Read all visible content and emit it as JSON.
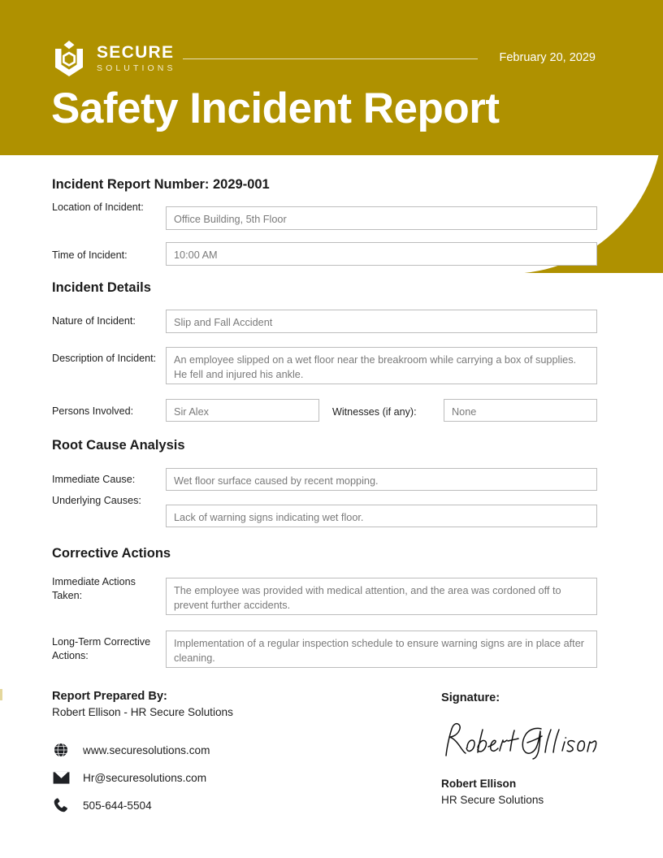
{
  "theme": {
    "brand_gold": "#AF9100",
    "text_dark": "#1B1B1B",
    "field_text": "#7A7A7A",
    "field_border": "#BDBDBD"
  },
  "header": {
    "logo_primary": "SECURE",
    "logo_secondary": "SOLUTIONS",
    "logo_icon": "shield-hexagon-logo-icon",
    "date": "February 20, 2029",
    "title": "Safety Incident Report"
  },
  "report": {
    "number_line": "Incident Report Number: 2029-001",
    "fields_top": [
      {
        "label": "Location of Incident:",
        "value": "Office Building, 5th Floor"
      },
      {
        "label": "Time of Incident:",
        "value": "10:00 AM"
      }
    ]
  },
  "sections": [
    {
      "heading": "Incident Details",
      "fields": [
        {
          "label": "Nature of Incident:",
          "value": "Slip and Fall Accident"
        },
        {
          "label": "Description of Incident:",
          "value": "An employee slipped on a wet floor near the breakroom while carrying a box of supplies. He fell and injured his ankle."
        },
        {
          "label": "Persons Involved:",
          "value": "Sir Alex"
        },
        {
          "label": "Witnesses (if any):",
          "value": "None"
        }
      ]
    },
    {
      "heading": "Root Cause Analysis",
      "fields": [
        {
          "label": "Immediate Cause:",
          "value": "Wet floor surface caused by recent mopping."
        },
        {
          "label": "Underlying Causes:",
          "value": "Lack of warning signs indicating wet floor."
        }
      ]
    },
    {
      "heading": "Corrective Actions",
      "fields": [
        {
          "label": "Immediate Actions Taken:",
          "value": "The employee was provided with medical attention, and the area was cordoned off to prevent further accidents."
        },
        {
          "label": "Long-Term Corrective Actions:",
          "value": "Implementation of a regular inspection schedule to ensure warning signs are in place after cleaning."
        }
      ]
    }
  ],
  "footer": {
    "prepared_by_label": "Report Prepared By:",
    "prepared_by_name": "Robert Ellison - HR Secure Solutions",
    "contacts": [
      {
        "icon": "globe-icon",
        "text": "www.securesolutions.com"
      },
      {
        "icon": "envelope-icon",
        "text": "Hr@securesolutions.com"
      },
      {
        "icon": "phone-icon",
        "text": "505-644-5504"
      }
    ],
    "signature_label": "Signature:",
    "signature_script": "Robert Ellison",
    "signer_name": "Robert Ellison",
    "signer_org": "HR Secure Solutions"
  }
}
